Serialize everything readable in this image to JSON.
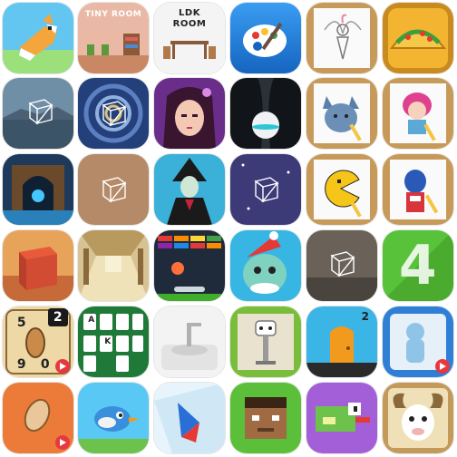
{
  "grid": {
    "rows": 6,
    "cols": 6
  },
  "apps": {
    "tiny_room": {
      "title": "TINY ROOM"
    },
    "ldk_room": {
      "title_line1": "LDK",
      "title_line2": "ROOM"
    },
    "number_card": {
      "top_left": "5",
      "badge": "2",
      "bottom_left": "9",
      "bottom_right": "0"
    },
    "cards_game": {
      "card_top": "A",
      "card_mid": "K"
    },
    "door_game": {
      "superscript": "2"
    },
    "number_four": {
      "digit": "4"
    }
  },
  "colors": {
    "background": "#ffffff",
    "accent_red": "#e8383d",
    "accent_green": "#3fae2a",
    "accent_blue": "#1f7ae0"
  }
}
